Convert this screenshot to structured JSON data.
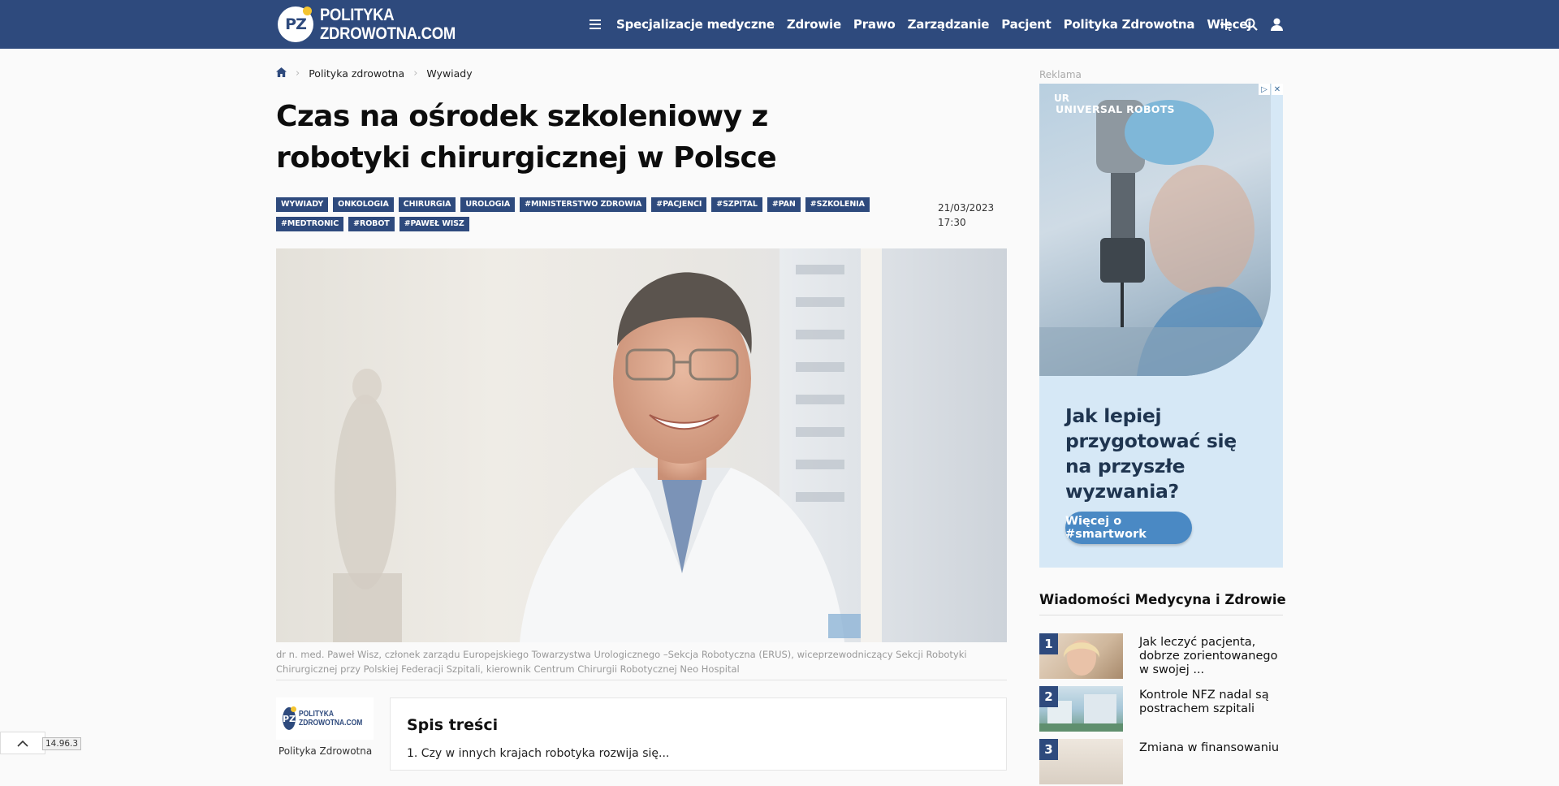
{
  "header": {
    "logo_badge": "PZ",
    "logo_line1": "POLITYKA",
    "logo_line2": "ZDROWOTNA.COM",
    "nav": [
      "Specjalizacje medyczne",
      "Zdrowie",
      "Prawo",
      "Zarządzanie",
      "Pacjent",
      "Polityka Zdrowotna",
      "Więcej"
    ],
    "icons": [
      "plus-icon",
      "search-icon",
      "user-icon"
    ],
    "colors": {
      "bar": "#2e4a7d",
      "accent_dot": "#f4c430"
    }
  },
  "breadcrumb": {
    "items": [
      "Polityka zdrowotna",
      "Wywiady"
    ]
  },
  "article": {
    "title": "Czas na ośrodek szkoleniowy z robotyki chirurgicznej w Polsce",
    "tags": [
      "WYWIADY",
      "ONKOLOGIA",
      "CHIRURGIA",
      "UROLOGIA",
      "#MINISTERSTWO ZDROWIA",
      "#PACJENCI",
      "#SZPITAL",
      "#PAN",
      "#SZKOLENIA",
      "#MEDTRONIC",
      "#ROBOT",
      "#PAWEŁ WISZ"
    ],
    "date": "21/03/2023",
    "time": "17:30",
    "caption": "dr n. med. Paweł Wisz, członek zarządu Europejskiego Towarzystwa Urologicznego –Sekcja Robotyczna (ERUS), wiceprzewodniczący Sekcji Robotyki Chirurgicznej przy Polskiej Federacji Szpitali, kierownik Centrum Chirurgii Robotycznej Neo Hospital",
    "author_logo_badge": "PZ",
    "author_logo_line1": "POLITYKA",
    "author_logo_line2": "ZDROWOTNA.COM",
    "author_name": "Polityka Zdrowotna",
    "toc_title": "Spis treści",
    "toc_first": "1. Czy w innych krajach robotyka rozwija się..."
  },
  "sidebar": {
    "ad_label": "Reklama",
    "ad_ur": "UR",
    "ad_brand": "UNIVERSAL ROBOTS",
    "ad_headline": "Jak lepiej przygotować się na przyszłe wyzwania?",
    "ad_button": "Więcej o #smartwork",
    "ad_close_icons": [
      "adchoices-icon",
      "close-icon"
    ],
    "news_title": "Wiadomości Medycyna i Zdrowie",
    "news": [
      {
        "num": "1",
        "text": "Jak leczyć pacjenta, dobrze zorientowanego w swojej ..."
      },
      {
        "num": "2",
        "text": "Kontrole NFZ nadal są postrachem szpitali"
      },
      {
        "num": "3",
        "text": "Zmiana w finansowaniu"
      }
    ]
  },
  "footer": {
    "scroll_top_icon": "chevron-up-icon",
    "version": "14.96.3"
  }
}
